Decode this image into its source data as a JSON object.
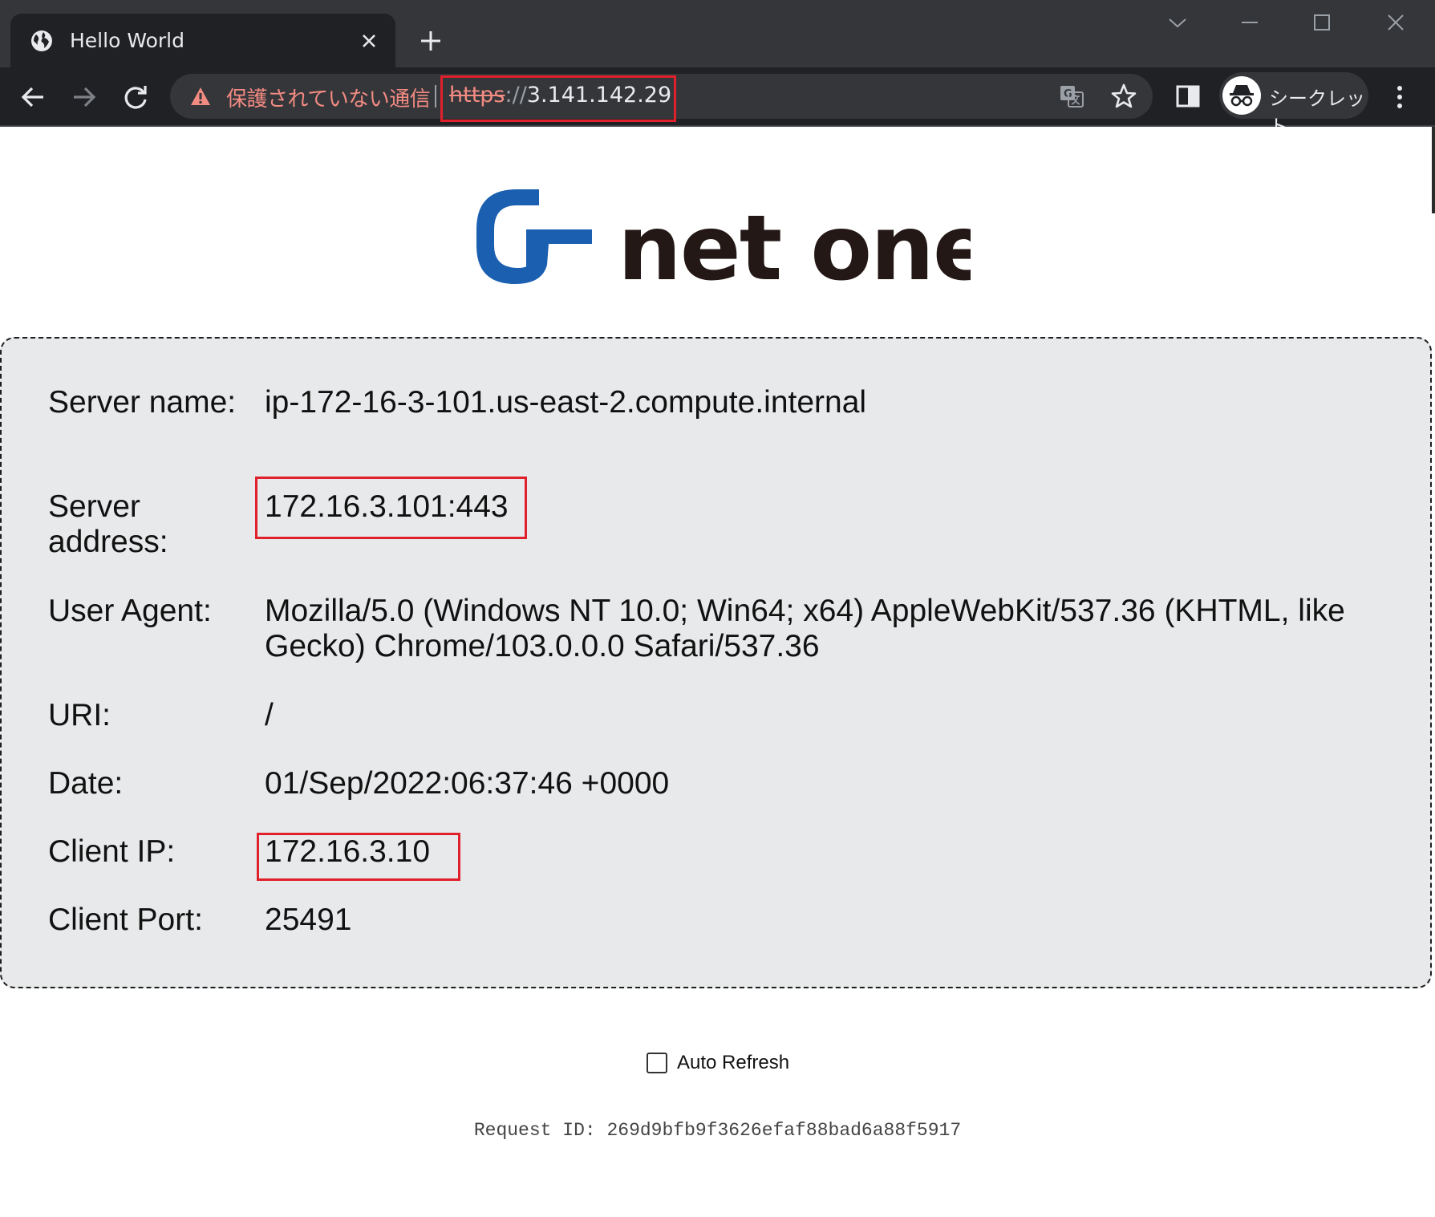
{
  "browser": {
    "tab_title": "Hello World",
    "insecure_label": "保護されていない通信",
    "url_scheme": "https",
    "url_slashes": "://",
    "url_host": "3.141.142.29",
    "incognito_label": "シークレット"
  },
  "page": {
    "logo_text": "net one",
    "rows": [
      {
        "key": "Server name:",
        "value": "ip-172-16-3-101.us-east-2.compute.internal"
      },
      {
        "key": "Server address:",
        "value": "172.16.3.101:443"
      },
      {
        "key": "User Agent:",
        "value": "Mozilla/5.0 (Windows NT 10.0; Win64; x64) AppleWebKit/537.36 (KHTML, like Gecko) Chrome/103.0.0.0 Safari/537.36"
      },
      {
        "key": "URI:",
        "value": "/"
      },
      {
        "key": "Date:",
        "value": "01/Sep/2022:06:37:46 +0000"
      },
      {
        "key": "Client IP:",
        "value": "172.16.3.10"
      },
      {
        "key": "Client Port:",
        "value": "25491"
      }
    ],
    "auto_refresh_label": "Auto Refresh",
    "auto_refresh_checked": false,
    "request_id_text": "Request ID: 269d9bfb9f3626efaf88bad6a88f5917"
  },
  "colors": {
    "highlight_box": "#e0202b",
    "logo_blue": "#1b5fb0",
    "logo_text": "#231815"
  }
}
